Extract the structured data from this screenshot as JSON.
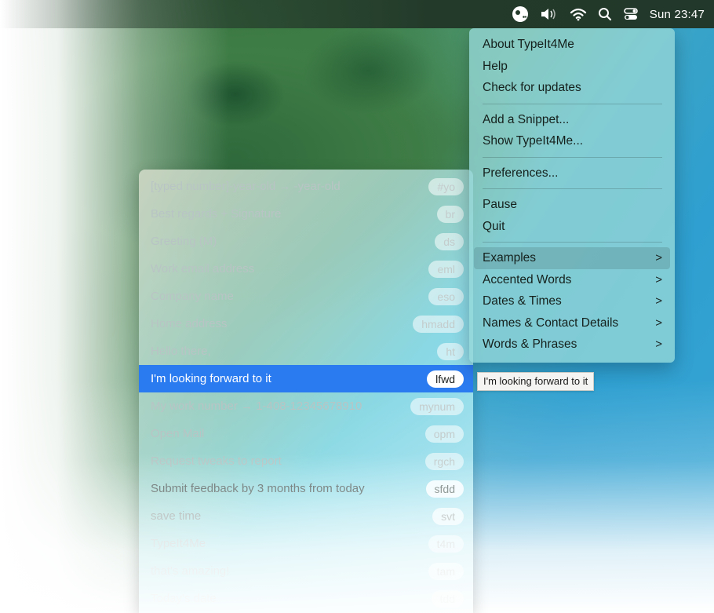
{
  "menubar": {
    "icons": [
      "typeit4me-icon",
      "volume-icon",
      "wifi-icon",
      "search-icon",
      "control-center-icon"
    ],
    "clock": "Sun 23:47"
  },
  "menu": {
    "items": [
      {
        "label": "About TypeIt4Me"
      },
      {
        "label": "Help"
      },
      {
        "label": "Check for updates"
      },
      {
        "label": "Add a Snippet..."
      },
      {
        "label": "Show TypeIt4Me..."
      },
      {
        "label": "Preferences..."
      },
      {
        "label": "Pause"
      },
      {
        "label": "Quit"
      },
      {
        "label": "Examples",
        "chevron": ">"
      },
      {
        "label": "Accented Words",
        "chevron": ">"
      },
      {
        "label": "Dates & Times",
        "chevron": ">"
      },
      {
        "label": "Names & Contact Details",
        "chevron": ">"
      },
      {
        "label": "Words & Phrases",
        "chevron": ">"
      }
    ]
  },
  "submenu": {
    "rows": [
      {
        "label": "[typed number]-year-old → -year-old",
        "abbr": "#yo"
      },
      {
        "label": "Best regards + Signature",
        "abbr": "br"
      },
      {
        "label": "Greeting (M)",
        "abbr": "ds"
      },
      {
        "label": "Work email address",
        "abbr": "eml"
      },
      {
        "label": "Company name",
        "abbr": "eso"
      },
      {
        "label": "Home address",
        "abbr": "hmadd"
      },
      {
        "label": "Hello there,",
        "abbr": "ht"
      },
      {
        "label": "I'm looking forward to it",
        "abbr": "lfwd"
      },
      {
        "label": "My work number → 1-408-12345678910",
        "abbr": "mynum"
      },
      {
        "label": "Open Mail",
        "abbr": "opm"
      },
      {
        "label": "Request tweaks to report",
        "abbr": "rgch"
      },
      {
        "label": "Submit feedback by 3 months from today",
        "abbr": "sfdd"
      },
      {
        "label": "save time",
        "abbr": "svt"
      },
      {
        "label": "TypeIt4Me",
        "abbr": "t4m"
      },
      {
        "label": "that's amazing!",
        "abbr": "tam"
      },
      {
        "label": "Today's date",
        "abbr": "tdd"
      }
    ]
  },
  "tooltip": {
    "text": "I'm looking forward to it"
  },
  "colors": {
    "selection": "#2b7bf0",
    "menu_bg": "#96d7d7"
  }
}
